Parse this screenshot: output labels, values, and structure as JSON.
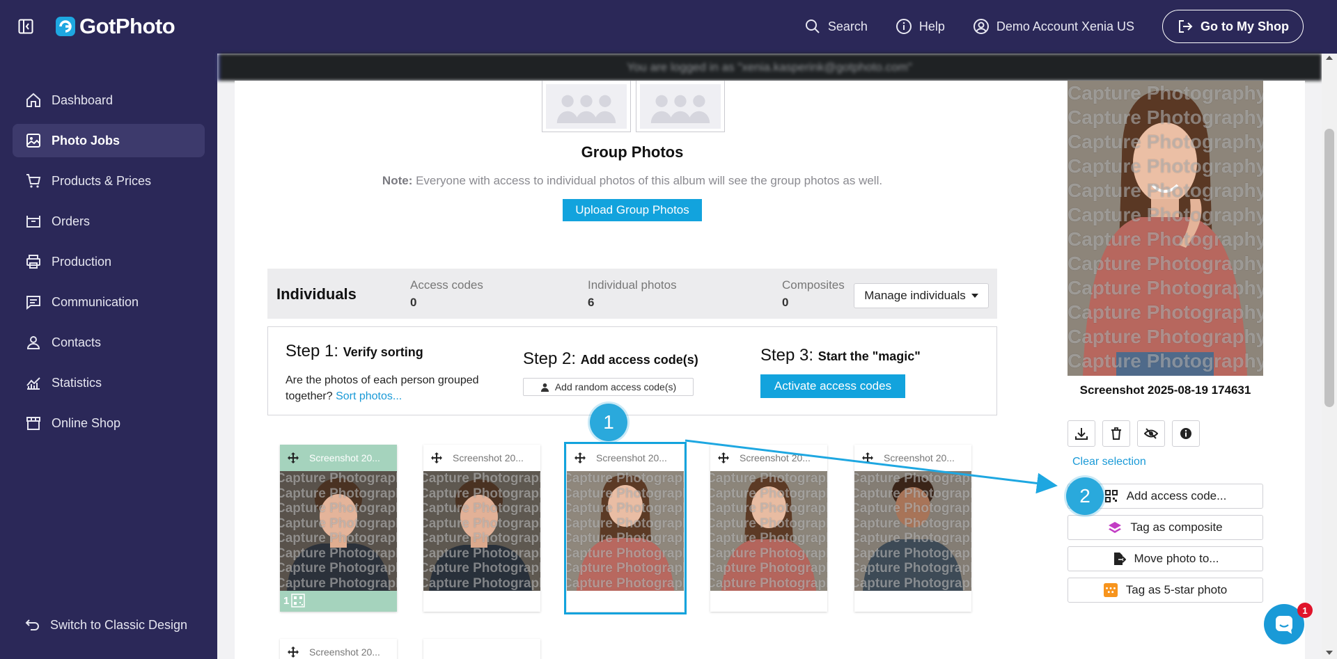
{
  "header": {
    "logo_text": "GotPhoto",
    "search_label": "Search",
    "help_label": "Help",
    "account_label": "Demo Account Xenia US",
    "shop_button_label": "Go to My Shop"
  },
  "sidebar": {
    "items": [
      {
        "label": "Dashboard",
        "icon": "home-icon"
      },
      {
        "label": "Photo Jobs",
        "icon": "image-icon",
        "active": true
      },
      {
        "label": "Products & Prices",
        "icon": "cart-icon"
      },
      {
        "label": "Orders",
        "icon": "box-icon"
      },
      {
        "label": "Production",
        "icon": "printer-icon"
      },
      {
        "label": "Communication",
        "icon": "message-icon"
      },
      {
        "label": "Contacts",
        "icon": "person-icon"
      },
      {
        "label": "Statistics",
        "icon": "chart-icon"
      },
      {
        "label": "Online Shop",
        "icon": "store-icon"
      }
    ],
    "classic_label": "Switch to Classic Design"
  },
  "impersonation_banner": "You are logged in as \"xenia.kasperink@gotphoto.com\"",
  "group": {
    "title": "Group Photos",
    "note_prefix": "Note:",
    "note_text": " Everyone with access to individual photos of this album will see the group photos as well.",
    "upload_label": "Upload Group Photos"
  },
  "individuals": {
    "title": "Individuals",
    "stats": [
      {
        "label": "Access codes",
        "value": "0"
      },
      {
        "label": "Individual photos",
        "value": "6"
      },
      {
        "label": "Composites",
        "value": "0"
      }
    ],
    "manage_label": "Manage individuals"
  },
  "steps": {
    "step1_num": "Step 1:",
    "step1_title": "Verify sorting",
    "step1_desc": "Are the photos of each person grouped together?",
    "step1_link": "Sort photos...",
    "step2_num": "Step 2:",
    "step2_title": "Add access code(s)",
    "step2_button": "Add random access code(s)",
    "step3_num": "Step 3:",
    "step3_title": "Start the \"magic\"",
    "step3_button": "Activate access codes"
  },
  "thumbnails": [
    {
      "label": "Screenshot 20...",
      "selected": true,
      "code_count": "1"
    },
    {
      "label": "Screenshot 20...",
      "selected": false
    },
    {
      "label": "Screenshot 20...",
      "selected": false,
      "active": true
    },
    {
      "label": "Screenshot 20...",
      "selected": false
    },
    {
      "label": "Screenshot 20...",
      "selected": false
    },
    {
      "label": "Screenshot 20...",
      "selected": false
    }
  ],
  "watermark_text": "Capture Photography",
  "panel": {
    "preview_title": "Screenshot 2025-08-19 174631",
    "clear_selection": "Clear selection",
    "actions": [
      "Add access code...",
      "Tag as composite",
      "Move photo to...",
      "Tag as 5-star photo"
    ]
  },
  "callouts": [
    "1",
    "2"
  ],
  "chat_badge": "1",
  "colors": {
    "nav_bg": "#2b2858",
    "accent": "#12a3dd",
    "selected_thumb": "#a5d3bd",
    "star_tag": "#f7941d",
    "composite_tag": "#c23cc4"
  }
}
